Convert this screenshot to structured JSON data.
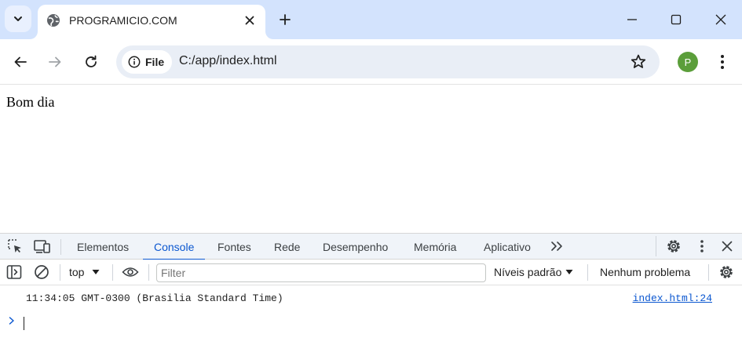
{
  "tab": {
    "title": "PROGRAMICIO.COM"
  },
  "toolbar": {
    "site_chip": "File",
    "url": "C:/app/index.html",
    "profile_initial": "P"
  },
  "page": {
    "text": "Bom dia"
  },
  "devtools": {
    "tabs": [
      "Elementos",
      "Console",
      "Fontes",
      "Rede",
      "Desempenho",
      "Memória",
      "Aplicativo"
    ],
    "active_tab": "Console",
    "context": "top",
    "filter_placeholder": "Filter",
    "levels": "Níveis padrão",
    "issues": "Nenhum problema",
    "messages": [
      {
        "text": "11:34:05 GMT-0300 (Brasilia Standard Time)",
        "source": "index.html:24"
      }
    ]
  },
  "colors": {
    "tabstrip": "#d3e3fd",
    "accent": "#0b57d0",
    "avatar": "#5b9e3a"
  }
}
